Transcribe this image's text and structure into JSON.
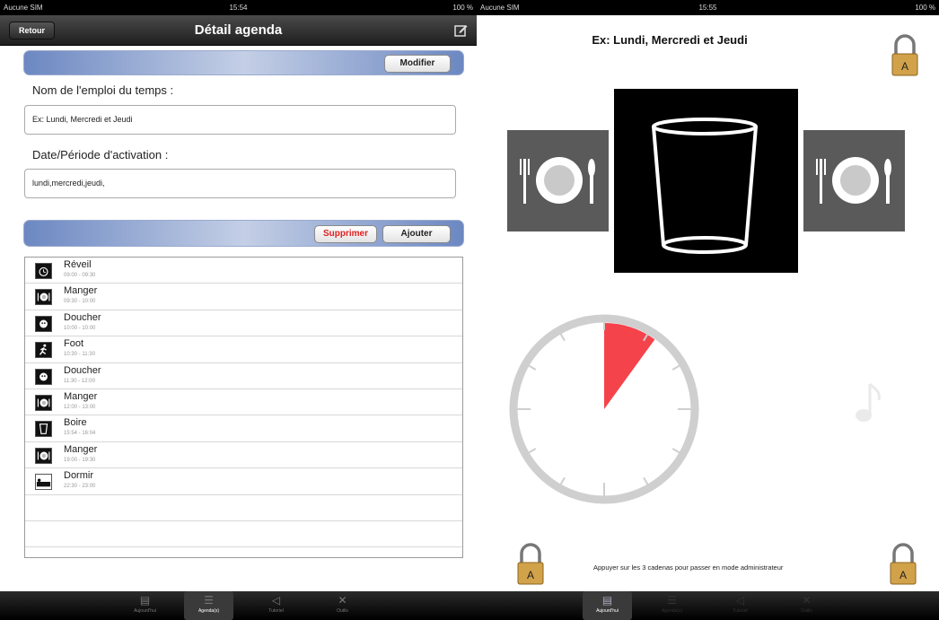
{
  "left": {
    "status": {
      "carrier": "Aucune SIM",
      "time": "15:54",
      "battery": "100 %"
    },
    "nav": {
      "back_label": "Retour",
      "title": "Détail agenda",
      "compose_icon": "compose-icon"
    },
    "modify_label": "Modifier",
    "schedule_name_label": "Nom de l'emploi du temps :",
    "schedule_name_value": "Ex: Lundi, Mercredi et Jeudi",
    "activation_label": "Date/Période d'activation :",
    "activation_value": "lundi,mercredi,jeudi,",
    "delete_label": "Supprimer",
    "add_label": "Ajouter",
    "delete_color": "#e02020",
    "events": [
      {
        "name": "Réveil",
        "time": "09:00 - 09:30",
        "icon": "alarm-icon"
      },
      {
        "name": "Manger",
        "time": "09:30 - 10:00",
        "icon": "plate-icon"
      },
      {
        "name": "Doucher",
        "time": "10:00 - 10:00",
        "icon": "shower-icon"
      },
      {
        "name": "Foot",
        "time": "10:30 - 11:30",
        "icon": "runner-icon"
      },
      {
        "name": "Doucher",
        "time": "11:30 - 12:00",
        "icon": "shower-icon"
      },
      {
        "name": "Manger",
        "time": "12:00 - 13:00",
        "icon": "plate-icon"
      },
      {
        "name": "Boire",
        "time": "15:54 - 16:04",
        "icon": "cup-icon"
      },
      {
        "name": "Manger",
        "time": "19:00 - 19:30",
        "icon": "plate-icon"
      },
      {
        "name": "Dormir",
        "time": "22:30 - 23:00",
        "icon": "bed-icon"
      }
    ],
    "tabs": [
      {
        "label": "Aujourd'hui",
        "icon": "calendar-icon",
        "active": false
      },
      {
        "label": "Agenda(s)",
        "icon": "list-icon",
        "active": true
      },
      {
        "label": "Tutoriel",
        "icon": "megaphone-icon",
        "active": false
      },
      {
        "label": "Outils",
        "icon": "tools-icon",
        "active": false
      }
    ]
  },
  "right": {
    "status": {
      "carrier": "Aucune SIM",
      "time": "15:55",
      "battery": "100 %"
    },
    "schedule_title": "Ex: Lundi, Mercredi et Jeudi",
    "lock_letter": "A",
    "admin_hint": "Appuyer sur les 3 cadenas pour passer en mode administrateur",
    "timer": {
      "remaining_fraction": 0.1,
      "accent": "#f5434b"
    },
    "tabs": [
      {
        "label": "Aujourd'hui",
        "icon": "calendar-icon",
        "active": true
      },
      {
        "label": "Agenda(s)",
        "icon": "list-icon",
        "active": false
      },
      {
        "label": "Tutoriel",
        "icon": "megaphone-icon",
        "active": false
      },
      {
        "label": "Outils",
        "icon": "tools-icon",
        "active": false
      }
    ]
  }
}
